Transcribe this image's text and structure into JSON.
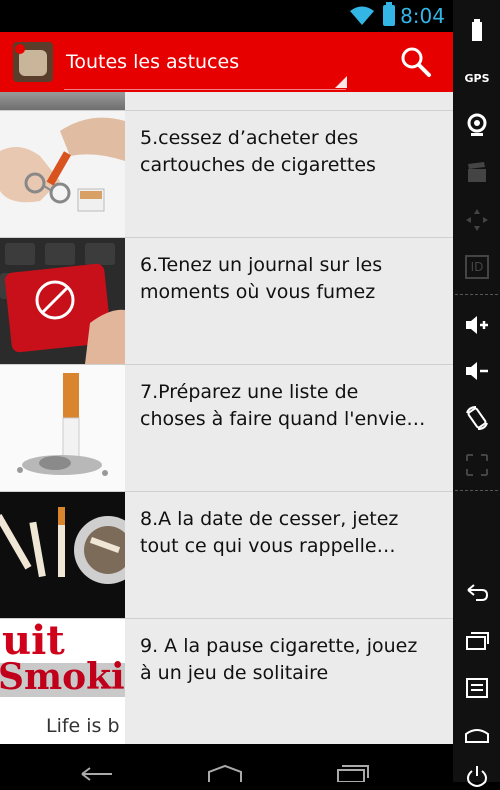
{
  "status_bar": {
    "time": "8:04",
    "accent_color": "#33b5e5"
  },
  "action_bar": {
    "title": "Toutes les astuces",
    "background": "#e60000"
  },
  "list": {
    "items": [
      {
        "line1": "5.cessez d’acheter des",
        "line2": "cartouches de cigarettes",
        "thumb": "handcuffed-cigarettes-image"
      },
      {
        "line1": "6.Tenez un journal sur les",
        "line2": "moments où vous fumez",
        "thumb": "no-smoking-keyboard-image"
      },
      {
        "line1": "7.Préparez une liste de",
        "line2": "choses à faire quand l'envie…",
        "thumb": "cigarette-butt-ashes-image"
      },
      {
        "line1": "8.A la date de cesser, jetez",
        "line2": "tout ce qui vous rappelle…",
        "thumb": "broken-cigarettes-ashtray-image"
      },
      {
        "line1": "9. A la pause cigarette, jouez",
        "line2": "à un jeu de solitaire",
        "thumb": "quit-smoking-life-image",
        "thumb_text_1": "uit",
        "thumb_text_2": "Smokin",
        "thumb_text_3": "Life is b"
      }
    ]
  },
  "side_panel": {
    "gps_label": "GPS",
    "id_label": "ID"
  }
}
